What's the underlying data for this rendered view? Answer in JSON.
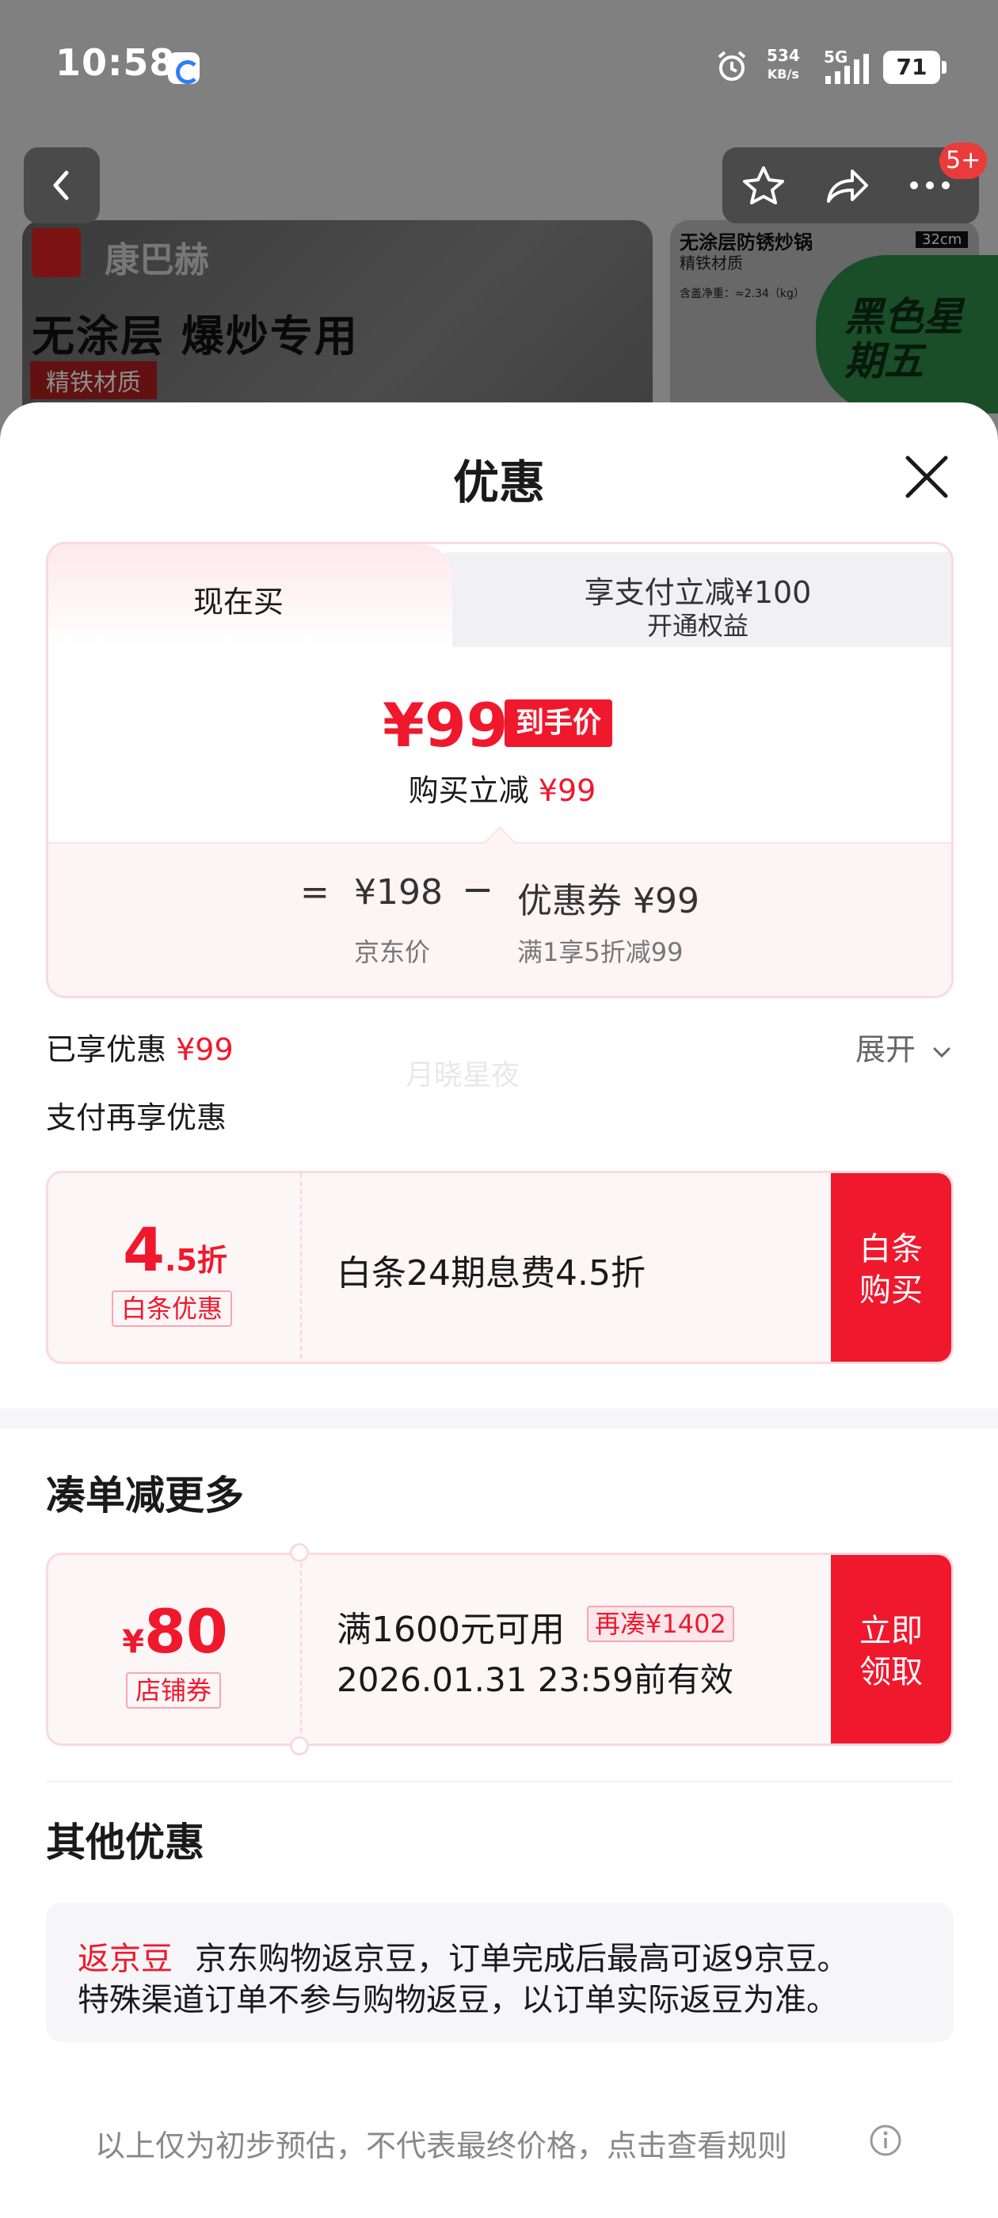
{
  "status_bar": {
    "time": "10:58",
    "net_speed_value": "534",
    "net_speed_unit": "KB/s",
    "network": "5G",
    "battery": "71"
  },
  "page_nav": {
    "badge": "5+"
  },
  "banner": {
    "brand": "康巴赫",
    "slogan": "无涂层 爆炒专用",
    "tag": "精铁材质",
    "right_title": "无涂层防锈炒锅",
    "right_sub": "精铁材质",
    "right_size": "32cm",
    "right_weight": "含盖净重：≈2.34（kg）",
    "promo": "黑色星期五"
  },
  "sheet": {
    "title": "优惠",
    "tabs": {
      "active": "现在买",
      "inactive_line1": "享支付立减¥100",
      "inactive_line2": "开通权益"
    },
    "price": {
      "value": "¥99",
      "tag": "到手价",
      "reduction_label": "购买立减",
      "reduction_value": "¥99",
      "equals": "=",
      "jd_price": "¥198",
      "minus": "−",
      "coupon": "优惠券 ¥99",
      "jd_price_label": "京东价",
      "coupon_label": "满1享5折减99"
    },
    "enjoyed_label": "已享优惠",
    "enjoyed_value": "¥99",
    "expand": "展开",
    "watermark": "月晓星夜",
    "pay_more": "支付再享优惠",
    "baitiao": {
      "discount_big": "4",
      "discount_small": ".5折",
      "label": "白条优惠",
      "text": "白条24期息费4.5折",
      "button_l1": "白条",
      "button_l2": "购买"
    },
    "more_title": "凑单减更多",
    "store_coupon": {
      "yen": "¥",
      "amount": "80",
      "label": "店铺券",
      "condition": "满1600元可用",
      "gap": "再凑¥1402",
      "expiry": "2026.01.31 23:59前有效",
      "button_l1": "立即",
      "button_l2": "领取"
    },
    "other_title": "其他优惠",
    "bean": {
      "tag": "返京豆",
      "line1": "京东购物返京豆，订单完成后最高可返9京豆。",
      "line2": "特殊渠道订单不参与购物返豆，以订单实际返豆为准。"
    },
    "footer": "以上仅为初步预估，不代表最终价格，点击查看规则"
  },
  "colors": {
    "accent": "#f0182c",
    "card_border": "#fbd9de"
  }
}
